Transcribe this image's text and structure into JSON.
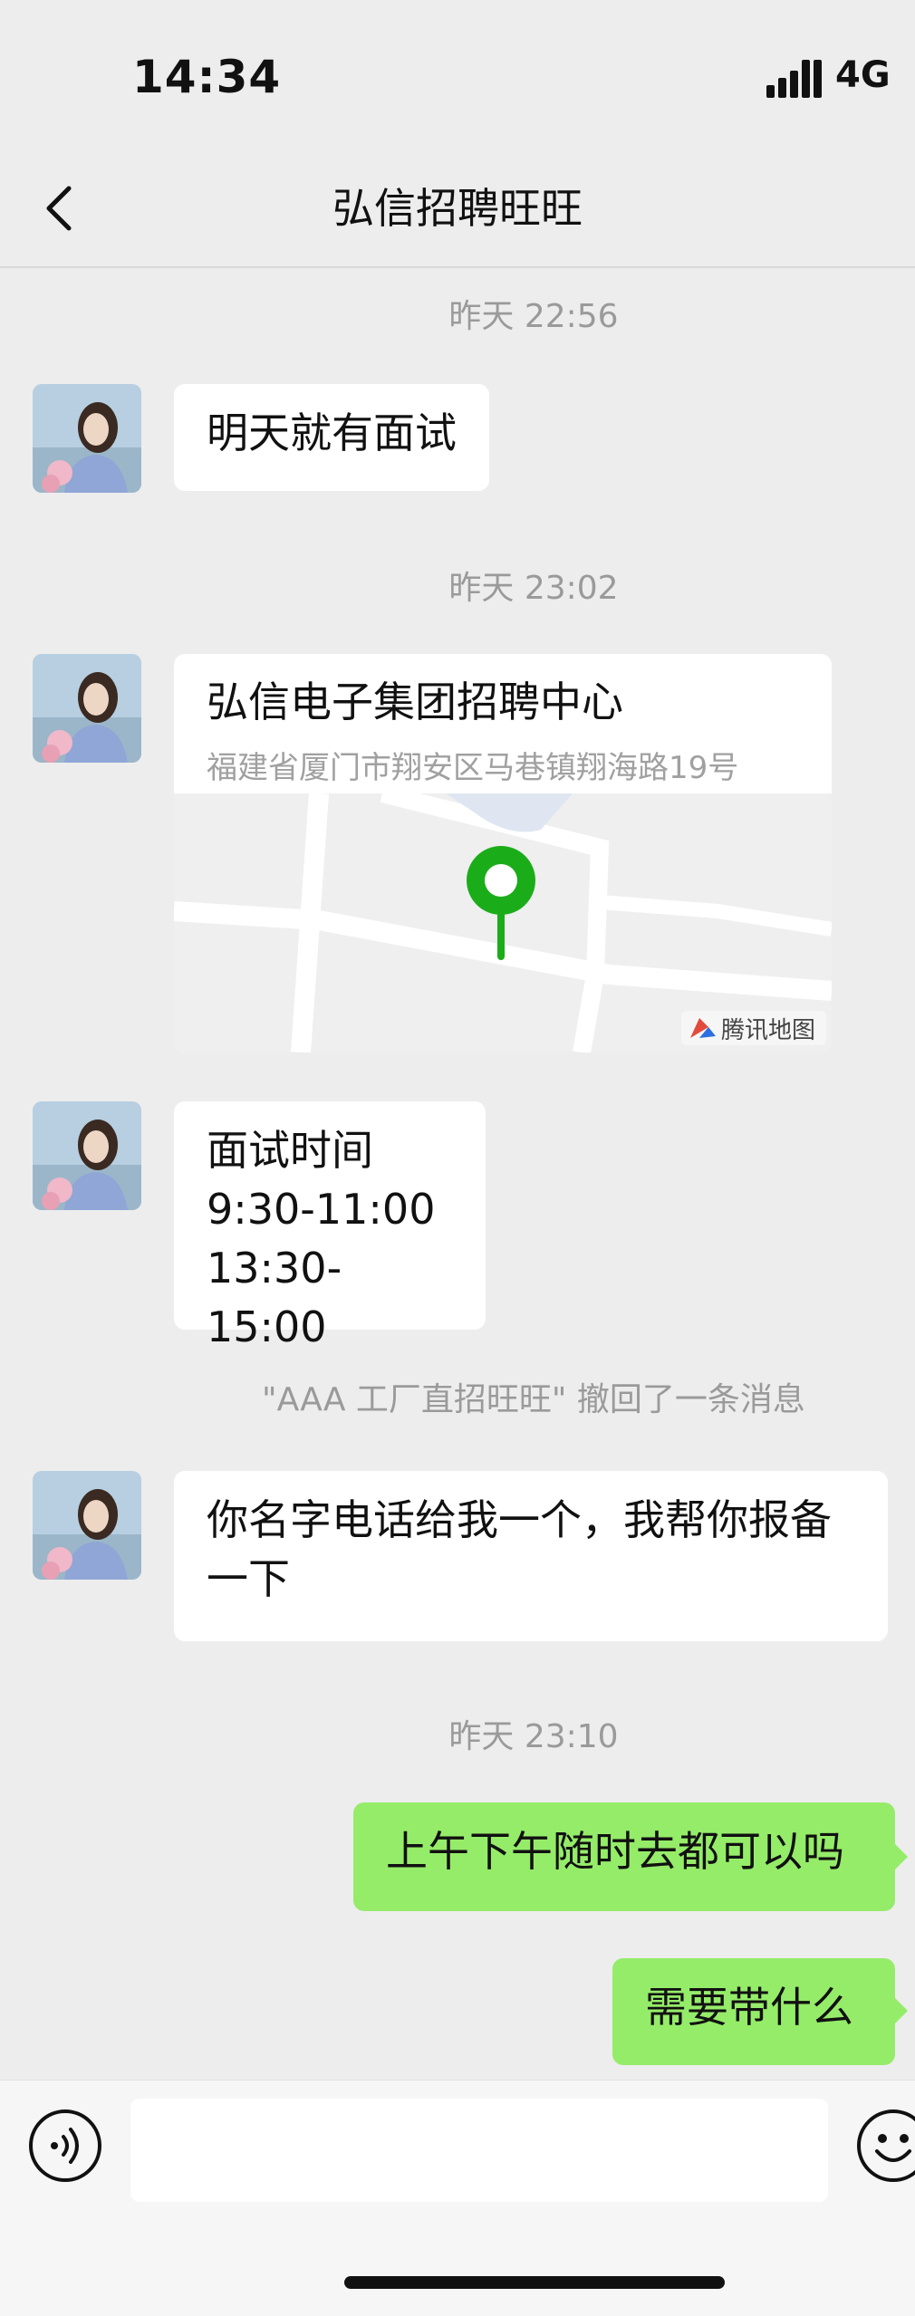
{
  "status_bar": {
    "time": "14:34",
    "network": "4G"
  },
  "header": {
    "title": "弘信招聘旺旺"
  },
  "messages": {
    "ts1": "昨天 22:56",
    "m1": "明天就有面试",
    "ts2": "昨天 23:02",
    "location": {
      "name": "弘信电子集团招聘中心",
      "address": "福建省厦门市翔安区马巷镇翔海路19号",
      "map_brand": "腾讯地图"
    },
    "m3": {
      "line1": "面试时间",
      "line2": "9:30-11:00",
      "line3": "13:30-15:00"
    },
    "recall": "\"AAA 工厂直招旺旺\" 撤回了一条消息",
    "m4": {
      "line1": "你名字电话给我一个，我帮你报备",
      "line2": "一下"
    },
    "ts3": "昨天 23:10",
    "m5": "上午下午随时去都可以吗",
    "m6": "需要带什么"
  },
  "icons": {
    "back": "chevron-left-icon",
    "voice": "voice-icon",
    "emoji": "emoji-icon",
    "location_pin": "map-pin-icon"
  },
  "colors": {
    "sent_bubble": "#95ec69",
    "received_bubble": "#ffffff",
    "pin": "#1aad19",
    "background": "#ededed"
  }
}
